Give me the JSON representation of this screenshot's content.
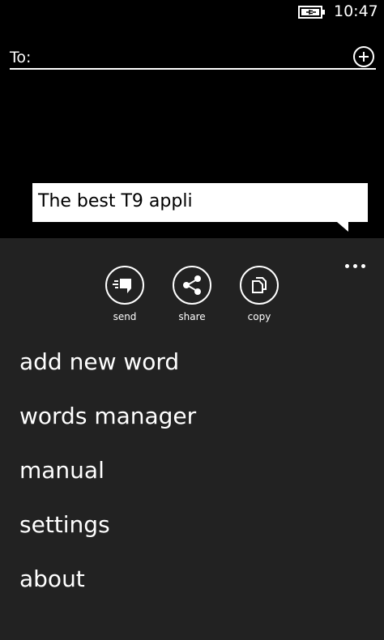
{
  "status_bar": {
    "time": "10:47",
    "battery_icon": "battery-charging-icon"
  },
  "compose": {
    "to_label": "To:",
    "add_recipient_icon": "add-circle-icon",
    "message_text": "The best T9 appli"
  },
  "app_bar": {
    "more_icon": "ellipsis-icon",
    "actions": [
      {
        "label": "send",
        "icon": "send-icon"
      },
      {
        "label": "share",
        "icon": "share-icon"
      },
      {
        "label": "copy",
        "icon": "copy-icon"
      }
    ],
    "menu_items": [
      {
        "label": "add new word"
      },
      {
        "label": "words manager"
      },
      {
        "label": "manual"
      },
      {
        "label": "settings"
      },
      {
        "label": "about"
      }
    ]
  },
  "colors": {
    "background": "#000000",
    "panel": "#222222",
    "foreground": "#ffffff"
  }
}
